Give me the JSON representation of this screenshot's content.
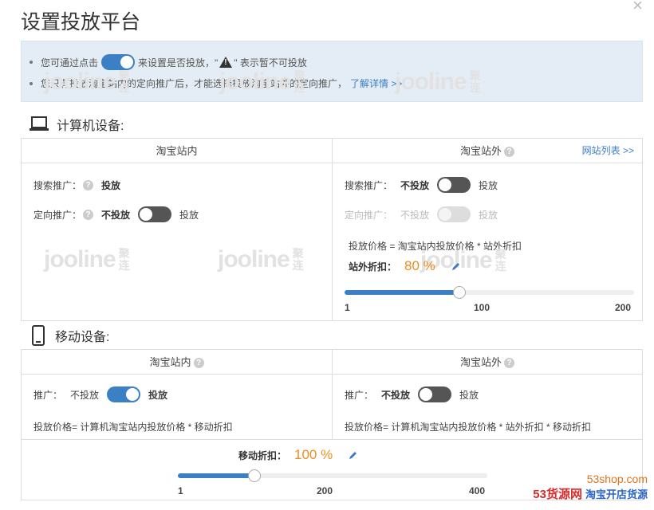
{
  "title": "设置投放平台",
  "close": "×",
  "notice": {
    "line1_pre": "您可通过点击",
    "line1_mid": "来设置是否投放，\"",
    "line1_post": "\" 表示暂不可投放",
    "warn_glyph": "!",
    "line2": "您只有投放淘宝站内的定向推广后，才能选择投放淘宝站外的定向推广，",
    "line2_link": "了解详情 >>"
  },
  "watermark": {
    "text": "jooline",
    "cn": "聚连"
  },
  "pc": {
    "heading": "计算机设备:",
    "left": {
      "header": "淘宝站内",
      "search_label": "搜索推广：",
      "search_value": "投放",
      "targeted_label": "定向推广：",
      "targeted_off": "不投放",
      "targeted_on": "投放"
    },
    "right": {
      "header": "淘宝站外",
      "site_list": "网站列表 >>",
      "search_label": "搜索推广：",
      "search_off": "不投放",
      "search_on": "投放",
      "targeted_label": "定向推广：",
      "targeted_off": "不投放",
      "targeted_on": "投放",
      "formula": "投放价格 = 淘宝站内投放价格 * 站外折扣",
      "rate_label": "站外折扣：",
      "rate_value": "80 %",
      "slider": {
        "min": "1",
        "mid": "100",
        "max": "200",
        "value": 80
      }
    }
  },
  "mobile": {
    "heading": "移动设备:",
    "left": {
      "header": "淘宝站内",
      "promo_label": "推广：",
      "promo_off": "不投放",
      "promo_on": "投放",
      "formula": "投放价格= 计算机淘宝站内投放价格 * 移动折扣"
    },
    "right": {
      "header": "淘宝站外",
      "promo_label": "推广：",
      "promo_off": "不投放",
      "promo_on": "投放",
      "formula": "投放价格= 计算机淘宝站内投放价格 * 站外折扣 * 移动折扣"
    },
    "rate_label": "移动折扣：",
    "rate_value": "100 %",
    "slider": {
      "min": "1",
      "mid": "200",
      "max": "400",
      "value": 100
    }
  },
  "brand": {
    "domain": "53shop.com",
    "name": "53货源网",
    "slogan": "淘宝开店货源"
  },
  "colors": {
    "accent": "#3b7fc4",
    "orange": "#f08c1e",
    "notice_bg": "#e4edf5"
  }
}
